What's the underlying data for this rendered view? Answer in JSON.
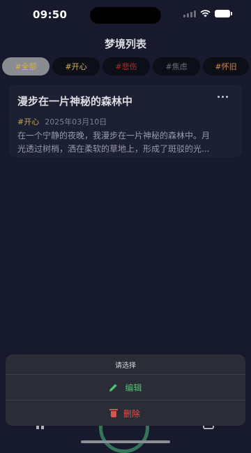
{
  "status": {
    "time": "09:50"
  },
  "header": {
    "title": "梦境列表"
  },
  "filters": [
    {
      "label": "#全部",
      "color": "#d4b44e",
      "active": true
    },
    {
      "label": "#开心",
      "color": "#d4b44e",
      "active": false
    },
    {
      "label": "#悲伤",
      "color": "#a8302f",
      "active": false
    },
    {
      "label": "#焦虑",
      "color": "#6c6e78",
      "active": false
    },
    {
      "label": "#怀旧",
      "color": "#d08a52",
      "active": false
    }
  ],
  "dream": {
    "title": "漫步在一片神秘的森林中",
    "tag": "#开心",
    "date": "2025年03月10日",
    "excerpt_line1": "在一个宁静的夜晚，我漫步在一片神秘的森林中。月",
    "excerpt_line2": "光透过树梢，洒在柔软的草地上，形成了斑驳的光..."
  },
  "action_sheet": {
    "title": "请选择",
    "edit_label": "编辑",
    "delete_label": "删除"
  },
  "icons": {
    "edit": "pencil-icon",
    "delete": "trash-icon",
    "more": "more-dots-icon"
  },
  "colors": {
    "background": "#161a2c",
    "accent_green": "#4fc173",
    "danger_red": "#d9534f",
    "tag_gold": "#c9a64a"
  }
}
